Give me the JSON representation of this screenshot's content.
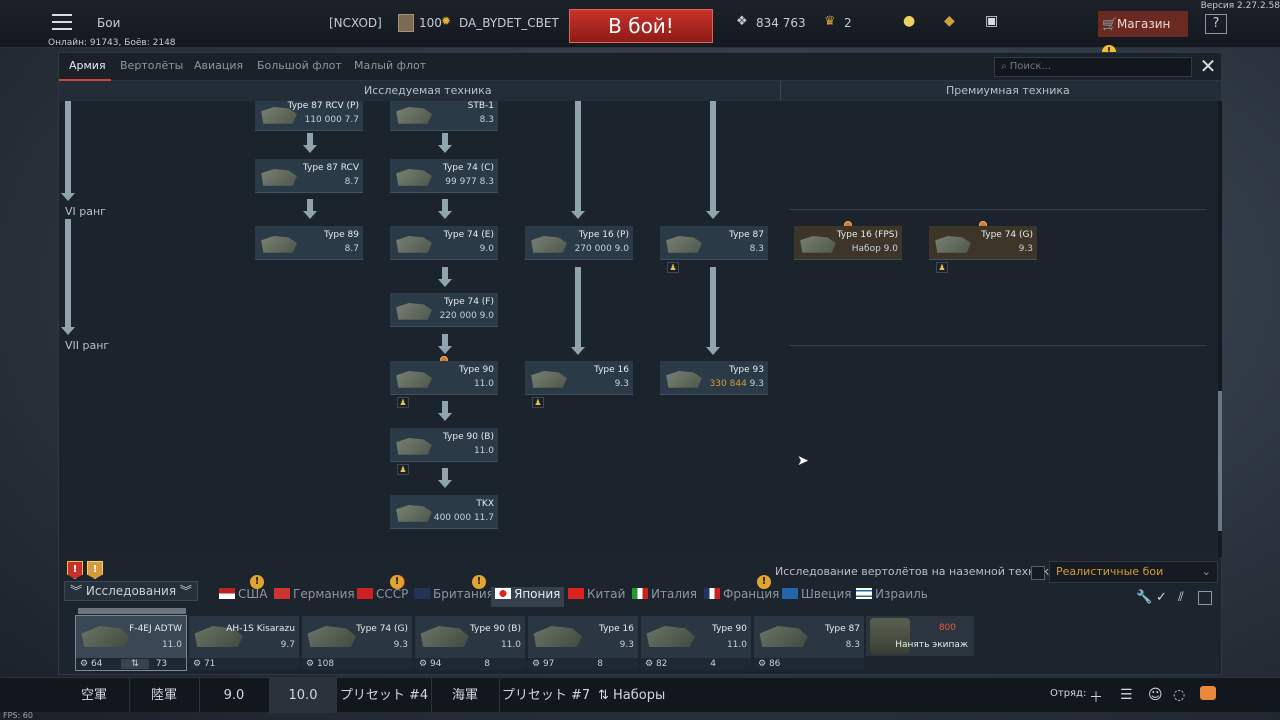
{
  "topbar": {
    "battles": "Бои",
    "clan": "[NCXOD]",
    "level": "100",
    "nickname": "DA_BYDET_CBET",
    "battle_button": "В бой!",
    "silver": "834 763",
    "gold_eagles": "2",
    "shop": "Магазин",
    "help": "?",
    "version": "Версия 2.27.2.58",
    "online": "Онлайн: 91743, Боёв: 2148"
  },
  "tabs": {
    "items": [
      "Армия",
      "Вертолёты",
      "Авиация",
      "Большой флот",
      "Малый флот"
    ],
    "active": "Армия",
    "search_placeholder": "Поиск..."
  },
  "tree": {
    "col_researched": "Исследуемая техника",
    "col_premium": "Премиумная техника",
    "rank_vi": "VI ранг",
    "rank_vii": "VII ранг",
    "vehicles": [
      {
        "id": "v-type87rcv-top",
        "name": "Type 87 RCV (P)",
        "stat": "110 000",
        "br": "7.7"
      },
      {
        "id": "v-stb1",
        "name": "STB-1",
        "stat": "",
        "br": "8.3"
      },
      {
        "id": "v-type87rcv",
        "name": "Type 87 RCV",
        "stat": "",
        "br": "8.7"
      },
      {
        "id": "v-type74c",
        "name": "Type 74 (C)",
        "stat": "99 977",
        "br": "8.3"
      },
      {
        "id": "v-type89",
        "name": "Type 89",
        "stat": "",
        "br": "8.7"
      },
      {
        "id": "v-type74e",
        "name": "Type 74 (E)",
        "stat": "",
        "br": "9.0"
      },
      {
        "id": "v-type16p",
        "name": "Type 16 (P)",
        "stat": "270 000",
        "br": "9.0"
      },
      {
        "id": "v-type87",
        "name": "Type 87",
        "stat": "",
        "br": "8.3"
      },
      {
        "id": "v-type74f",
        "name": "Type 74 (F)",
        "stat": "220 000",
        "br": "9.0"
      },
      {
        "id": "v-type90",
        "name": "Type 90",
        "stat": "",
        "br": "11.0"
      },
      {
        "id": "v-type16",
        "name": "Type 16",
        "stat": "",
        "br": "9.3"
      },
      {
        "id": "v-type93",
        "name": "Type 93",
        "stat": "330 844",
        "br": "9.3"
      },
      {
        "id": "v-type90b",
        "name": "Type 90 (B)",
        "stat": "",
        "br": "11.0"
      },
      {
        "id": "v-tkx",
        "name": "TKX",
        "stat": "400 000",
        "br": "11.7"
      }
    ],
    "premium": [
      {
        "id": "p-type16fps",
        "name": "Type 16 (FPS)",
        "stat": "Набор",
        "br": "9.0"
      },
      {
        "id": "p-type74g",
        "name": "Type 74 (G)",
        "stat": "",
        "br": "9.3"
      }
    ]
  },
  "bottom_panel": {
    "heli_text": "Исследование вертолётов на наземной технике",
    "mode": "Реалистичные бои",
    "research": "Исследования",
    "nations": [
      "США",
      "Германия",
      "СССР",
      "Британия",
      "Япония",
      "Китай",
      "Италия",
      "Франция",
      "Швеция",
      "Израиль"
    ],
    "active_nation": "Япония"
  },
  "slots": [
    {
      "name": "F-4EJ ADTW",
      "br": "11.0",
      "crew": "64",
      "extra": "73"
    },
    {
      "name": "AH-1S Kisarazu",
      "br": "9.7",
      "crew": "71",
      "extra": ""
    },
    {
      "name": "Type 74 (G)",
      "br": "9.3",
      "crew": "108",
      "extra": ""
    },
    {
      "name": "Type 90 (B)",
      "br": "11.0",
      "crew": "94",
      "extra": "8"
    },
    {
      "name": "Type 16",
      "br": "9.3",
      "crew": "97",
      "extra": "8"
    },
    {
      "name": "Type 90",
      "br": "11.0",
      "crew": "82",
      "extra": "4"
    },
    {
      "name": "Type 87",
      "br": "8.3",
      "crew": "86",
      "extra": ""
    }
  ],
  "hire": {
    "cost": "800",
    "label": "Нанять экипаж"
  },
  "bottombar": {
    "items": [
      "空軍",
      "陸軍",
      "9.0",
      "10.0",
      "プリセット #4",
      "海軍",
      "プリセット #7",
      "Наборы"
    ],
    "squad": "Отряд:",
    "fps": "FPS: 60"
  },
  "colors": {
    "accent": "#c8322a",
    "gold": "#d59a3c",
    "panel": "#1c242d"
  }
}
